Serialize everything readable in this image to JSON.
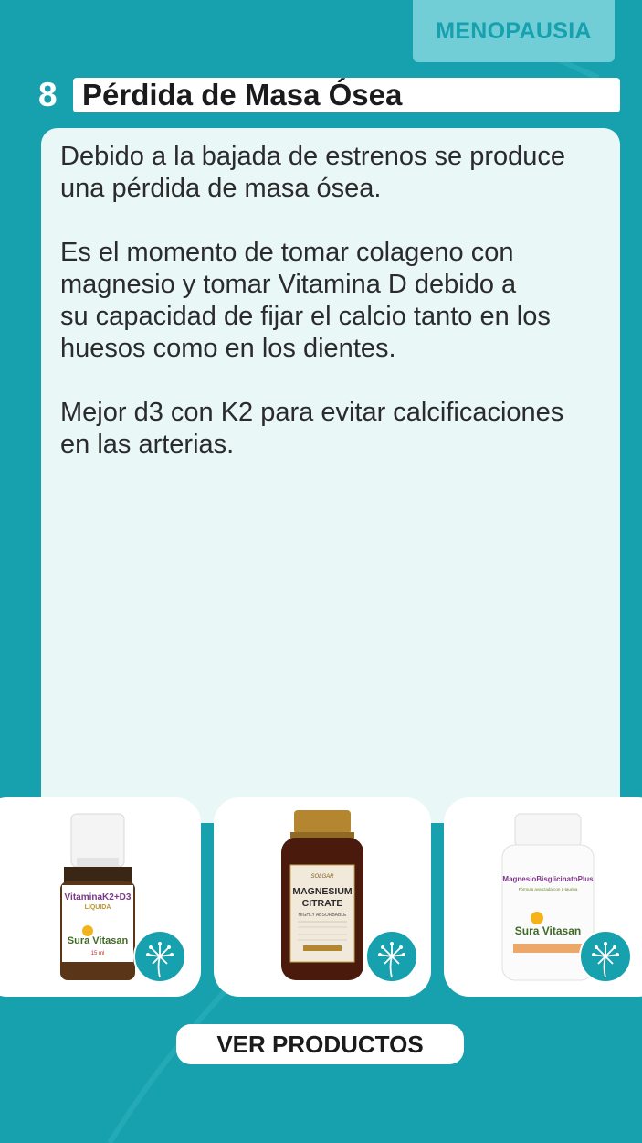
{
  "category_tag": "MENOPAUSIA",
  "section": {
    "number": "8",
    "title": "Pérdida de Masa Ósea"
  },
  "body": {
    "paragraphs": [
      "Debido a la bajada de estrenos se produce\nuna pérdida de masa ósea.",
      "Es el momento de tomar colageno con\nmagnesio y tomar Vitamina D debido a\nsu capacidad de fijar el calcio tanto en los\nhuesos como en los dientes.",
      "Mejor d3 con K2 para evitar calcificaciones\nen las arterias."
    ]
  },
  "products": [
    {
      "name_line1": "VitaminaK2+D3",
      "name_line2": "LÍQUIDA",
      "brand": "Sura Vitasan",
      "size": "15 ml",
      "icon": "dandelion-icon"
    },
    {
      "name_line1": "MAGNESIUM",
      "name_line2": "CITRATE",
      "brand": "SOLGAR",
      "subtitle": "HIGHLY ABSORBABLE",
      "icon": "dandelion-icon"
    },
    {
      "name_line1": "MagnesioBisglicinatoPlus",
      "name_line2": "Fórmula avanzada con L-taurina",
      "brand": "Sura Vitasan",
      "icon": "dandelion-icon"
    }
  ],
  "cta_label": "VER PRODUCTOS",
  "colors": {
    "background": "#17a0ad",
    "tag_background": "#71cdd6",
    "card_background": "#e9f7f7",
    "text": "#2b2b2b"
  }
}
